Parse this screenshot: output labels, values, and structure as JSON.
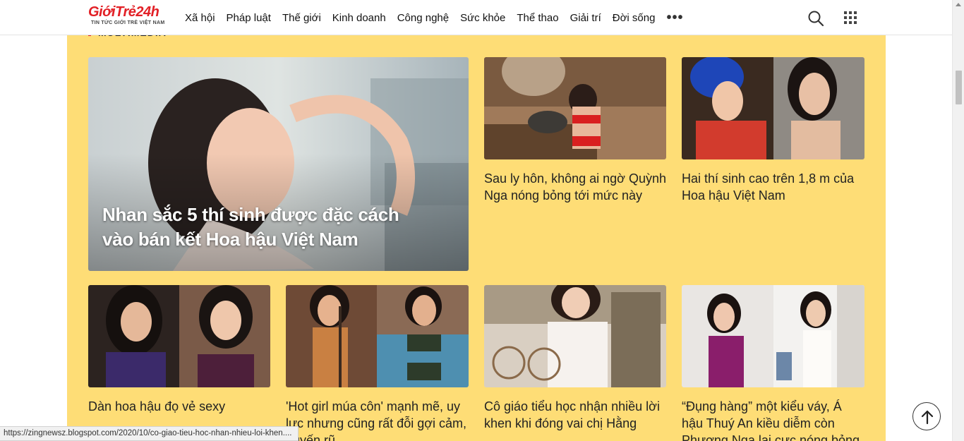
{
  "header": {
    "logo_main_a": "Giới",
    "logo_main_b": "Trẻ24h",
    "logo_sub": "TIN TỨC GIỚI TRẺ VIỆT NAM",
    "nav": [
      "Xã hội",
      "Pháp luật",
      "Thế giới",
      "Kinh doanh",
      "Công nghệ",
      "Sức khỏe",
      "Thể thao",
      "Giải trí",
      "Đời sống"
    ],
    "more": "•••"
  },
  "section": {
    "title": "MULTIMEDIA",
    "background": "#fedd76"
  },
  "featured": {
    "title": "Nhan sắc 5 thí sinh được đặc cách vào bán kết Hoa hậu Việt Nam"
  },
  "articles": [
    {
      "title": "Sau ly hôn, không ai ngờ Quỳnh Nga nóng bỏng tới mức này"
    },
    {
      "title": "Hai thí sinh cao trên 1,8 m của Hoa hậu Việt Nam"
    },
    {
      "title": "Dàn hoa hậu đọ vẻ sexy"
    },
    {
      "title": "'Hot girl múa côn' mạnh mẽ, uy lực nhưng cũng rất đỗi gợi cảm, quyến rũ"
    },
    {
      "title": "Cô giáo tiểu học nhận nhiều lời khen khi đóng vai chị Hằng"
    },
    {
      "title": "“Đụng hàng” một kiểu váy, Á hậu Thuý An kiều diễm còn Phương Nga lại cực nóng bỏng"
    }
  ],
  "status_url": "https://zingnewsz.blogspot.com/2020/10/co-giao-tieu-hoc-nhan-nhieu-loi-khen....",
  "colors": {
    "accent": "#e22026",
    "section_bg": "#fedd76"
  },
  "icons": {
    "search": "search-icon",
    "apps": "apps-grid-icon",
    "back_to_top": "arrow-up-icon"
  }
}
